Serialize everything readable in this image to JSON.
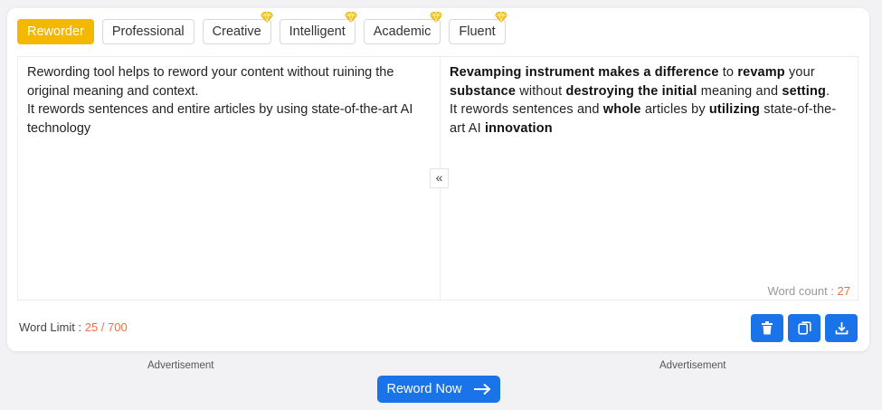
{
  "modes": [
    {
      "label": "Reworder",
      "active": true,
      "premium": false
    },
    {
      "label": "Professional",
      "active": false,
      "premium": false
    },
    {
      "label": "Creative",
      "active": false,
      "premium": true
    },
    {
      "label": "Intelligent",
      "active": false,
      "premium": true
    },
    {
      "label": "Academic",
      "active": false,
      "premium": true
    },
    {
      "label": "Fluent",
      "active": false,
      "premium": true
    }
  ],
  "input": {
    "line1": "Rewording tool helps to reword your content without ruining the original meaning and context.",
    "line2": "It rewords sentences and entire articles by using state-of-the-art AI technology"
  },
  "output": {
    "segments": [
      {
        "t": "Revamping instrument makes a difference",
        "b": true
      },
      {
        "t": " to ",
        "b": false
      },
      {
        "t": "revamp",
        "b": true
      },
      {
        "t": " your ",
        "b": false
      },
      {
        "t": "substance",
        "b": true
      },
      {
        "t": " without ",
        "b": false
      },
      {
        "t": "destroying the initial",
        "b": true
      },
      {
        "t": " meaning and ",
        "b": false
      },
      {
        "t": "setting",
        "b": true
      },
      {
        "t": ".",
        "b": false
      },
      {
        "t": "\n",
        "b": false
      },
      {
        "t": "It rewords sentences and ",
        "b": false
      },
      {
        "t": "whole",
        "b": true
      },
      {
        "t": " articles by ",
        "b": false
      },
      {
        "t": "utilizing",
        "b": true
      },
      {
        "t": " state-of-the-art AI ",
        "b": false
      },
      {
        "t": "innovation",
        "b": true
      }
    ]
  },
  "swap_icon": "«",
  "word_count": {
    "label": "Word count : ",
    "value": "27"
  },
  "word_limit": {
    "label": "Word Limit : ",
    "value": "25 / 700"
  },
  "actions": [
    {
      "name": "delete-button",
      "icon": "trash-icon"
    },
    {
      "name": "copy-button",
      "icon": "copy-icon"
    },
    {
      "name": "download-button",
      "icon": "download-icon"
    }
  ],
  "ads": {
    "left": "Advertisement",
    "right": "Advertisement"
  },
  "reword_button": {
    "label": "Reword Now",
    "icon": "arrow-right-icon"
  },
  "colors": {
    "accent": "#f5b800",
    "primary": "#1a73e8",
    "count": "#f07040"
  }
}
